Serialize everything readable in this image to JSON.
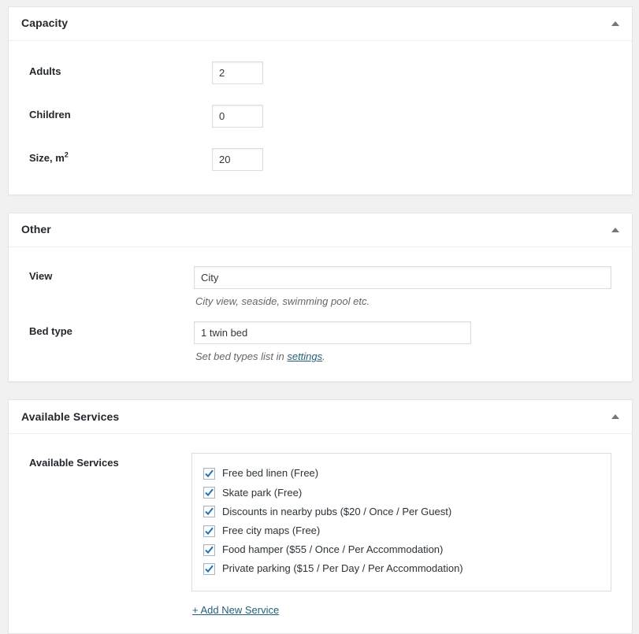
{
  "panels": [
    {
      "id": "capacity",
      "title": "Capacity",
      "toggle_icon": "caret-up-icon",
      "fields": [
        {
          "label": "Adults",
          "value": "2",
          "type": "number-input"
        },
        {
          "label": "Children",
          "value": "0",
          "type": "number-input"
        },
        {
          "label": "Size, m",
          "label_sup": "2",
          "value": "20",
          "type": "number-input"
        }
      ]
    },
    {
      "id": "other",
      "title": "Other",
      "toggle_icon": "caret-up-icon",
      "fields": [
        {
          "label": "View",
          "value": "City",
          "type": "text-input",
          "description": "City view, seaside, swimming pool etc."
        },
        {
          "label": "Bed type",
          "value": "1 twin bed",
          "type": "text-input",
          "description_before": "Set bed types list in ",
          "description_link": "settings",
          "description_after": "."
        }
      ]
    },
    {
      "id": "available-services",
      "title": "Available Services",
      "toggle_icon": "caret-up-icon",
      "field_label": "Available Services",
      "services": [
        {
          "label": "Free bed linen (Free)",
          "checked": true
        },
        {
          "label": "Skate park (Free)",
          "checked": true
        },
        {
          "label": "Discounts in nearby pubs ($20 / Once / Per Guest)",
          "checked": true
        },
        {
          "label": "Free city maps (Free)",
          "checked": true
        },
        {
          "label": "Food hamper ($55 / Once / Per Accommodation)",
          "checked": true
        },
        {
          "label": "Private parking ($15 / Per Day / Per Accommodation)",
          "checked": true
        }
      ],
      "add_service_label": "+ Add New Service"
    }
  ],
  "colors": {
    "page_background": "#f1f1f1",
    "panel_background": "#ffffff",
    "border": "#e5e5e5",
    "text": "#23282d",
    "link": "#21607a",
    "checkbox_tick": "#2271b1",
    "checkbox_border": "#a5b6c4"
  }
}
